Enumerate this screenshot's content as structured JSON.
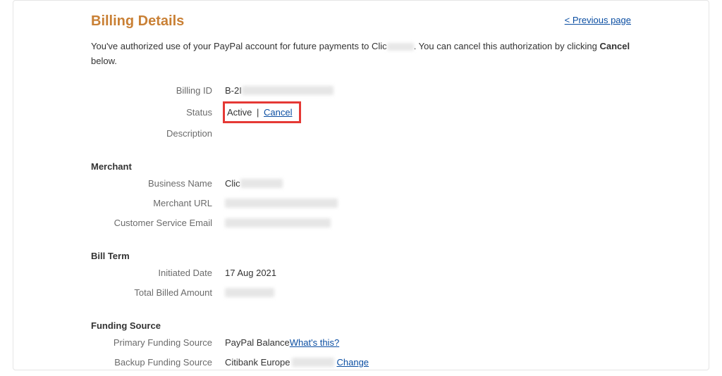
{
  "header": {
    "title": "Billing Details",
    "previous_link": "< Previous page"
  },
  "intro": {
    "text_a": "You've authorized use of your PayPal account for future payments to Clic",
    "text_b": ". You can cancel this authorization by clicking ",
    "bold_word": "Cancel",
    "text_c": " below."
  },
  "details": {
    "billing_id_label": "Billing ID",
    "billing_id_prefix": "B-2I",
    "status_label": "Status",
    "status_value": "Active",
    "status_sep": " | ",
    "cancel_link": "Cancel",
    "description_label": "Description"
  },
  "merchant": {
    "section": "Merchant",
    "business_name_label": "Business Name",
    "business_name_prefix": "Clic",
    "merchant_url_label": "Merchant URL",
    "customer_email_label": "Customer Service Email"
  },
  "bill_term": {
    "section": "Bill Term",
    "initiated_label": "Initiated Date",
    "initiated_value": "17 Aug 2021",
    "total_billed_label": "Total Billed Amount"
  },
  "funding": {
    "section": "Funding Source",
    "primary_label": "Primary Funding Source",
    "primary_value": "PayPal Balance ",
    "whats_this": "What's this?",
    "backup_label": "Backup Funding Source",
    "backup_prefix": "Citibank Europe",
    "change_link": "Change"
  }
}
